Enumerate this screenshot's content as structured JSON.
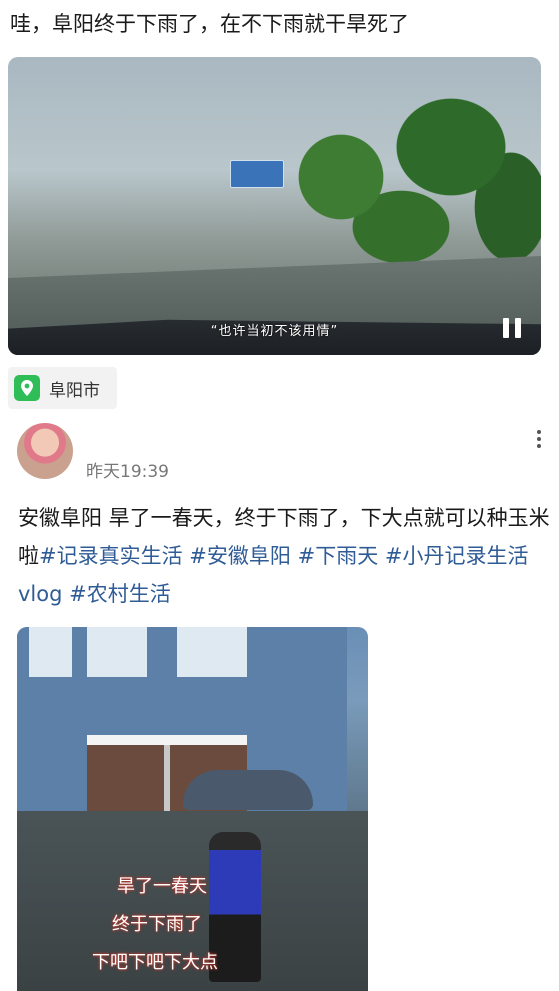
{
  "post1": {
    "text": "哇，阜阳终于下雨了，在不下雨就干旱死了",
    "video": {
      "caption": "“也许当初不该用情”"
    }
  },
  "location": {
    "icon": "location-pin-icon",
    "label": "阜阳市"
  },
  "post2": {
    "timestamp": "昨天19:39",
    "body_text": "安徽阜阳 旱了一春天，终于下雨了，下大点就可以种玉米啦",
    "tags": [
      "#记录真实生活",
      "#安徽阜阳",
      "#下雨天",
      "#小丹记录生活vlog",
      "#农村生活"
    ],
    "video": {
      "subtitle_lines": [
        "旱了一春天",
        "终于下雨了",
        "下吧下吧下大点"
      ]
    }
  },
  "colors": {
    "tag": "#2f5c96",
    "location_icon": "#2fbd58",
    "timestamp": "#777777"
  }
}
